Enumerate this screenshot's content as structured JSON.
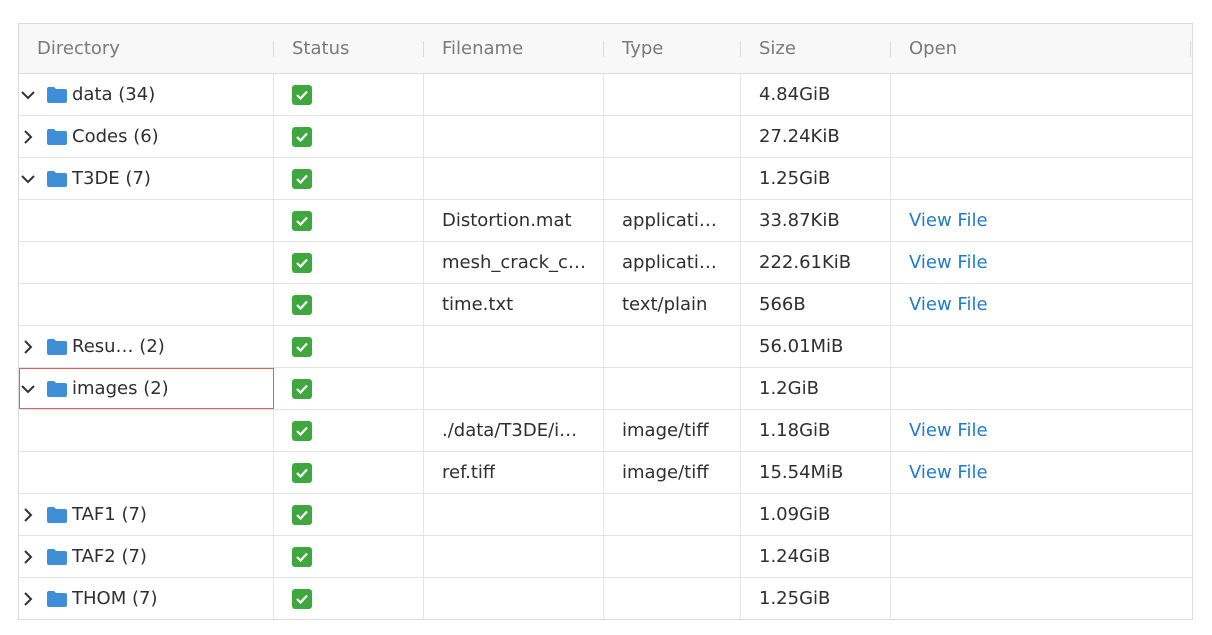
{
  "headers": {
    "directory": "Directory",
    "status": "Status",
    "filename": "Filename",
    "type": "Type",
    "size": "Size",
    "open": "Open"
  },
  "rows": [
    {
      "name": "data",
      "count": "(34)",
      "expanded": true,
      "filename": "",
      "type": "",
      "size": "4.84GiB",
      "open": ""
    },
    {
      "name": "Codes",
      "count": "(6)",
      "expanded": false,
      "filename": "",
      "type": "",
      "size": "27.24KiB",
      "open": ""
    },
    {
      "name": "T3DE",
      "count": "(7)",
      "expanded": true,
      "filename": "",
      "type": "",
      "size": "1.25GiB",
      "open": ""
    },
    {
      "name": "",
      "count": "",
      "expanded": null,
      "filename": "Distortion.mat",
      "type": "applicati…",
      "size": "33.87KiB",
      "open": "View File"
    },
    {
      "name": "",
      "count": "",
      "expanded": null,
      "filename": "mesh_crack_c…",
      "type": "applicati…",
      "size": "222.61KiB",
      "open": "View File"
    },
    {
      "name": "",
      "count": "",
      "expanded": null,
      "filename": "time.txt",
      "type": "text/plain",
      "size": "566B",
      "open": "View File"
    },
    {
      "name": "Resu…",
      "count": "(2)",
      "expanded": false,
      "filename": "",
      "type": "",
      "size": "56.01MiB",
      "open": ""
    },
    {
      "name": "images",
      "count": "(2)",
      "expanded": true,
      "filename": "",
      "type": "",
      "size": "1.2GiB",
      "open": ""
    },
    {
      "name": "",
      "count": "",
      "expanded": null,
      "filename": "./data/T3DE/i…",
      "type": "image/tiff",
      "size": "1.18GiB",
      "open": "View File"
    },
    {
      "name": "",
      "count": "",
      "expanded": null,
      "filename": "ref.tiff",
      "type": "image/tiff",
      "size": "15.54MiB",
      "open": "View File"
    },
    {
      "name": "TAF1",
      "count": "(7)",
      "expanded": false,
      "filename": "",
      "type": "",
      "size": "1.09GiB",
      "open": ""
    },
    {
      "name": "TAF2",
      "count": "(7)",
      "expanded": false,
      "filename": "",
      "type": "",
      "size": "1.24GiB",
      "open": ""
    },
    {
      "name": "THOM",
      "count": "(7)",
      "expanded": false,
      "filename": "",
      "type": "",
      "size": "1.25GiB",
      "open": ""
    }
  ],
  "colors": {
    "folder": "#3f8fd8",
    "status_ok": "#3ea83e",
    "link": "#1e7bd0",
    "selection_outline": "#e06060"
  },
  "icons": {
    "status": "check-mark-icon",
    "folder": "folder-icon",
    "expanded": "chevron-down-icon",
    "collapsed": "chevron-right-icon"
  }
}
